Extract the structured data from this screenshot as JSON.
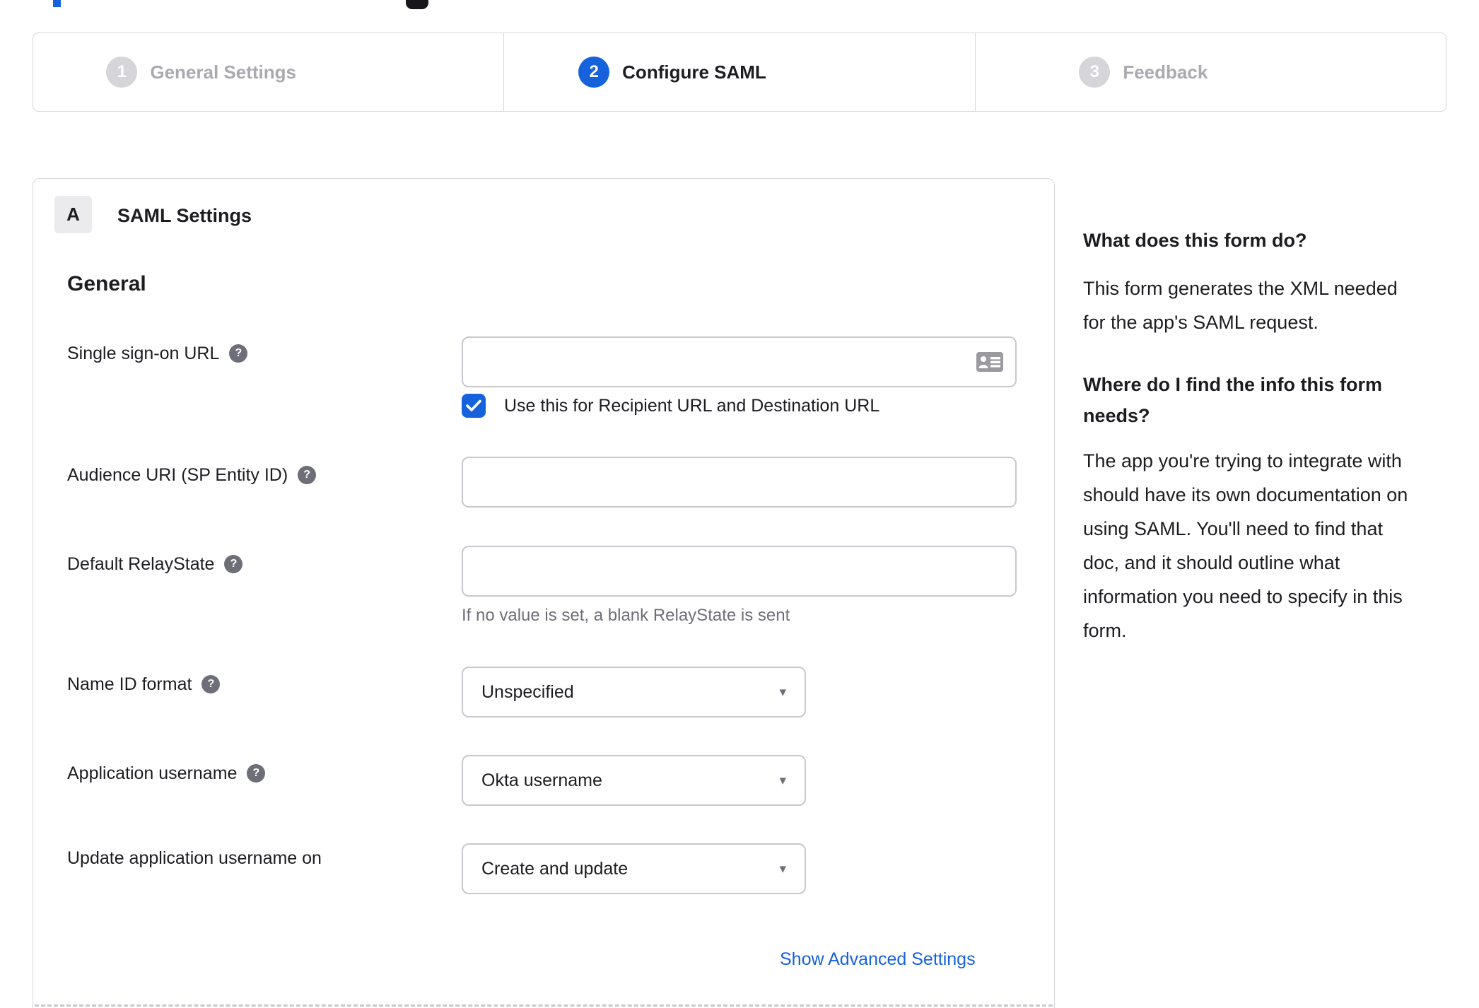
{
  "colors": {
    "accent_blue": "#1662dd",
    "text_dark": "#1d1d21",
    "muted_gray": "#6e6e78",
    "border_gray": "#d7d7dc",
    "inactive_step_gray": "#d5d5da"
  },
  "glyphs": {
    "help": "?",
    "caret": "▾"
  },
  "stepper": {
    "steps": [
      {
        "number": "1",
        "label": "General Settings",
        "state": "inactive"
      },
      {
        "number": "2",
        "label": "Configure SAML",
        "state": "active"
      },
      {
        "number": "3",
        "label": "Feedback",
        "state": "inactive"
      }
    ]
  },
  "saml_panel": {
    "badge": "A",
    "title": "SAML Settings",
    "section_heading": "General",
    "fields": {
      "sso_url": {
        "label": "Single sign-on URL",
        "value": ""
      },
      "sso_checkbox": {
        "label": "Use this for Recipient URL and Destination URL",
        "checked": true
      },
      "audience_uri": {
        "label": "Audience URI (SP Entity ID)",
        "value": ""
      },
      "relay_state": {
        "label": "Default RelayState",
        "value": "",
        "helper": "If no value is set, a blank RelayState is sent"
      },
      "name_id_format": {
        "label": "Name ID format",
        "value": "Unspecified"
      },
      "app_username": {
        "label": "Application username",
        "value": "Okta username"
      },
      "update_app_username": {
        "label": "Update application username on",
        "value": "Create and update"
      }
    },
    "advanced_settings_link": "Show Advanced Settings"
  },
  "help_panel": {
    "q1_title": "What does this form do?",
    "q1_body": "This form generates the XML needed\nfor the app's SAML request.",
    "q2_title": "Where do I find the info this form\nneeds?",
    "q2_body": "The app you're trying to integrate with\nshould have its own documentation on\nusing SAML. You'll need to find that\ndoc, and it should outline what\ninformation you need to specify in this\nform."
  }
}
